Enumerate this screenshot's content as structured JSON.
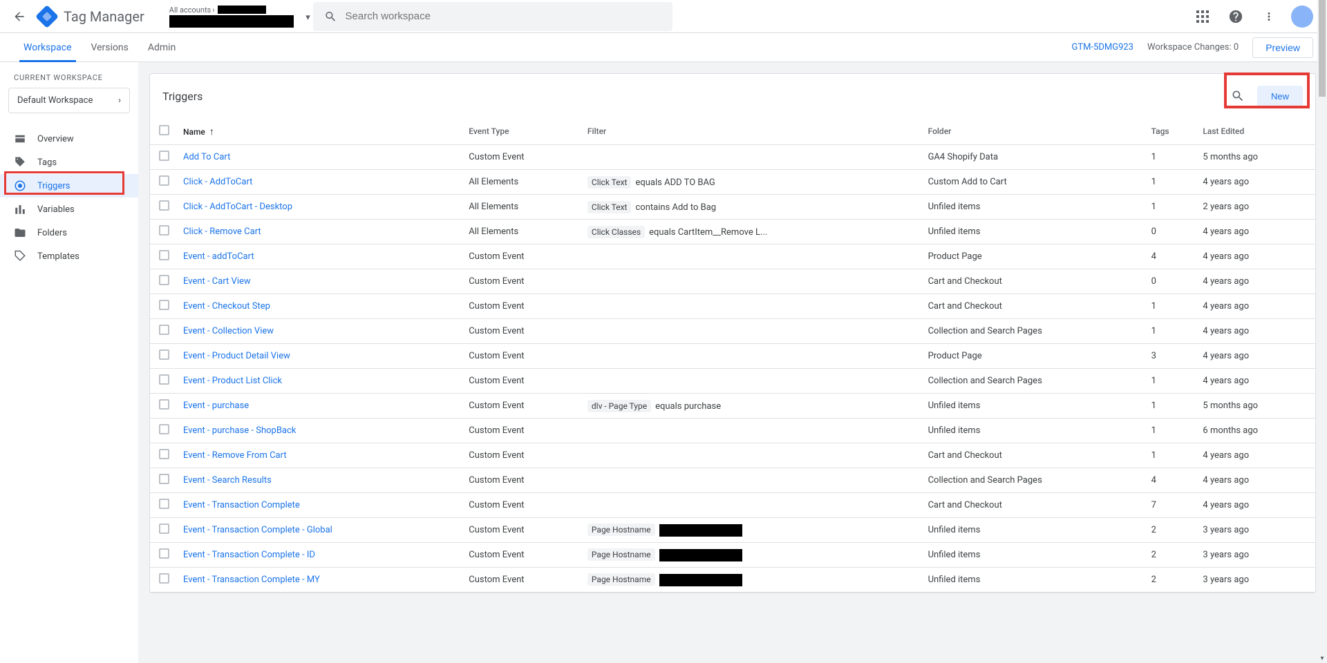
{
  "header": {
    "product_name": "Tag Manager",
    "breadcrumb_prefix": "All accounts",
    "search_placeholder": "Search workspace"
  },
  "nav": {
    "workspace": "Workspace",
    "versions": "Versions",
    "admin": "Admin",
    "container_id": "GTM-5DMG923",
    "changes_label": "Workspace Changes:",
    "changes_count": "0",
    "preview": "Preview"
  },
  "sidebar": {
    "ws_label": "CURRENT WORKSPACE",
    "ws_name": "Default Workspace",
    "items": [
      {
        "label": "Overview"
      },
      {
        "label": "Tags"
      },
      {
        "label": "Triggers"
      },
      {
        "label": "Variables"
      },
      {
        "label": "Folders"
      },
      {
        "label": "Templates"
      }
    ]
  },
  "panel": {
    "title": "Triggers",
    "new_btn": "New",
    "columns": {
      "name": "Name",
      "event": "Event Type",
      "filter": "Filter",
      "folder": "Folder",
      "tags": "Tags",
      "edited": "Last Edited"
    }
  },
  "rows": [
    {
      "name": "Add To Cart",
      "event": "Custom Event",
      "filter_chip": "",
      "filter_text": "",
      "folder": "GA4 Shopify Data",
      "tags": "1",
      "edited": "5 months ago"
    },
    {
      "name": "Click - AddToCart",
      "event": "All Elements",
      "filter_chip": "Click Text",
      "filter_text": "equals ADD TO BAG",
      "folder": "Custom Add to Cart",
      "tags": "1",
      "edited": "4 years ago"
    },
    {
      "name": "Click - AddToCart - Desktop",
      "event": "All Elements",
      "filter_chip": "Click Text",
      "filter_text": "contains Add to Bag",
      "folder": "Unfiled items",
      "tags": "1",
      "edited": "2 years ago"
    },
    {
      "name": "Click - Remove Cart",
      "event": "All Elements",
      "filter_chip": "Click Classes",
      "filter_text": "equals CartItem__Remove L...",
      "folder": "Unfiled items",
      "tags": "0",
      "edited": "4 years ago"
    },
    {
      "name": "Event - addToCart",
      "event": "Custom Event",
      "filter_chip": "",
      "filter_text": "",
      "folder": "Product Page",
      "tags": "4",
      "edited": "4 years ago"
    },
    {
      "name": "Event - Cart View",
      "event": "Custom Event",
      "filter_chip": "",
      "filter_text": "",
      "folder": "Cart and Checkout",
      "tags": "0",
      "edited": "4 years ago"
    },
    {
      "name": "Event - Checkout Step",
      "event": "Custom Event",
      "filter_chip": "",
      "filter_text": "",
      "folder": "Cart and Checkout",
      "tags": "1",
      "edited": "4 years ago"
    },
    {
      "name": "Event - Collection View",
      "event": "Custom Event",
      "filter_chip": "",
      "filter_text": "",
      "folder": "Collection and Search Pages",
      "tags": "1",
      "edited": "4 years ago"
    },
    {
      "name": "Event - Product Detail View",
      "event": "Custom Event",
      "filter_chip": "",
      "filter_text": "",
      "folder": "Product Page",
      "tags": "3",
      "edited": "4 years ago"
    },
    {
      "name": "Event - Product List Click",
      "event": "Custom Event",
      "filter_chip": "",
      "filter_text": "",
      "folder": "Collection and Search Pages",
      "tags": "1",
      "edited": "4 years ago"
    },
    {
      "name": "Event - purchase",
      "event": "Custom Event",
      "filter_chip": "dlv - Page Type",
      "filter_text": "equals purchase",
      "folder": "Unfiled items",
      "tags": "1",
      "edited": "5 months ago"
    },
    {
      "name": "Event - purchase - ShopBack",
      "event": "Custom Event",
      "filter_chip": "",
      "filter_text": "",
      "folder": "Unfiled items",
      "tags": "1",
      "edited": "6 months ago"
    },
    {
      "name": "Event - Remove From Cart",
      "event": "Custom Event",
      "filter_chip": "",
      "filter_text": "",
      "folder": "Cart and Checkout",
      "tags": "1",
      "edited": "4 years ago"
    },
    {
      "name": "Event - Search Results",
      "event": "Custom Event",
      "filter_chip": "",
      "filter_text": "",
      "folder": "Collection and Search Pages",
      "tags": "4",
      "edited": "4 years ago"
    },
    {
      "name": "Event - Transaction Complete",
      "event": "Custom Event",
      "filter_chip": "",
      "filter_text": "",
      "folder": "Cart and Checkout",
      "tags": "7",
      "edited": "4 years ago"
    },
    {
      "name": "Event - Transaction Complete - Global",
      "event": "Custom Event",
      "filter_chip": "Page Hostname",
      "filter_text": "__REDACTED__",
      "folder": "Unfiled items",
      "tags": "2",
      "edited": "3 years ago"
    },
    {
      "name": "Event - Transaction Complete - ID",
      "event": "Custom Event",
      "filter_chip": "Page Hostname",
      "filter_text": "__REDACTED__",
      "folder": "Unfiled items",
      "tags": "2",
      "edited": "3 years ago"
    },
    {
      "name": "Event - Transaction Complete - MY",
      "event": "Custom Event",
      "filter_chip": "Page Hostname",
      "filter_text": "__REDACTED__",
      "folder": "Unfiled items",
      "tags": "2",
      "edited": "3 years ago"
    }
  ]
}
